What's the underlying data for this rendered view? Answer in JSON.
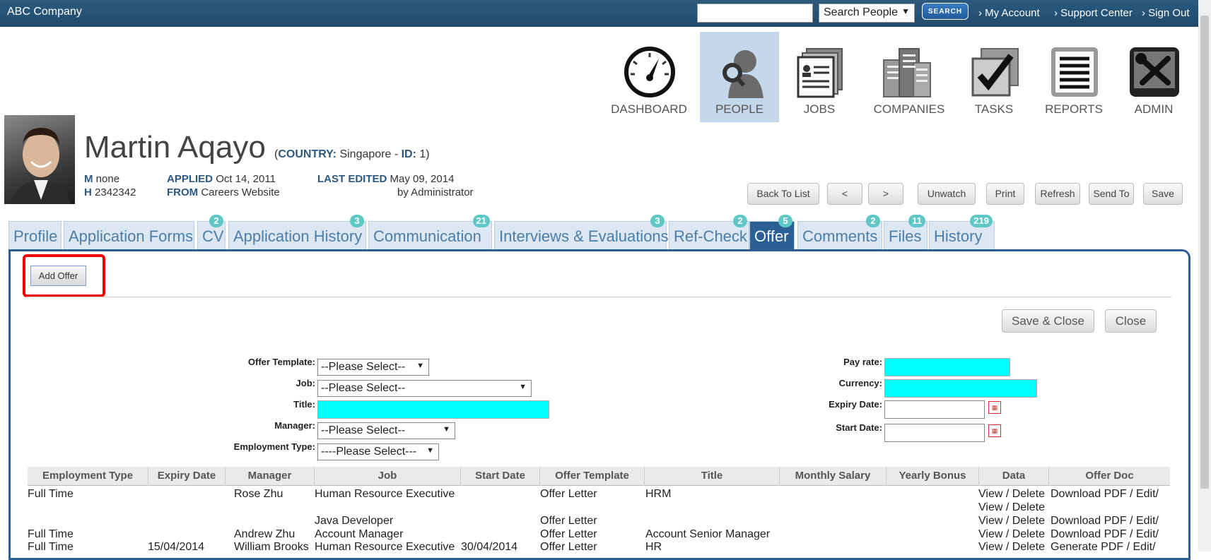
{
  "topbar": {
    "brand": "ABC Company",
    "search_type": "Search People",
    "search_button": "SEARCH",
    "links": [
      "› My Account",
      "› Support Center",
      "› Sign Out"
    ]
  },
  "nav": [
    {
      "label": "DASHBOARD",
      "icon": "dashboard-gauge-icon"
    },
    {
      "label": "PEOPLE",
      "icon": "people-icon"
    },
    {
      "label": "JOBS",
      "icon": "jobs-icon"
    },
    {
      "label": "COMPANIES",
      "icon": "companies-icon"
    },
    {
      "label": "TASKS",
      "icon": "tasks-icon"
    },
    {
      "label": "REPORTS",
      "icon": "reports-icon"
    },
    {
      "label": "ADMIN",
      "icon": "admin-icon"
    }
  ],
  "profile": {
    "name": "Martin Aqayo",
    "country_label": "COUNTRY:",
    "country_value": "Singapore",
    "id_label": "ID:",
    "id_value": "1",
    "m_label": "M",
    "m_value": "none",
    "h_label": "H",
    "h_value": "2342342",
    "applied_label": "APPLIED",
    "applied_value": "Oct 14, 2011",
    "from_label": "FROM",
    "from_value": "Careers Website",
    "last_edited_label": "LAST EDITED",
    "last_edited_value": "May 09, 2014",
    "edited_by": "by Administrator"
  },
  "actions": [
    "Back To List",
    "<",
    ">",
    "Unwatch",
    "Print",
    "Refresh",
    "Send To",
    "Save"
  ],
  "tabs": [
    {
      "label": "Profile",
      "badge": ""
    },
    {
      "label": "Application Forms",
      "badge": ""
    },
    {
      "label": "CV",
      "badge": "2"
    },
    {
      "label": "Application History",
      "badge": "3"
    },
    {
      "label": "Communication",
      "badge": "21"
    },
    {
      "label": "Interviews & Evaluations",
      "badge": "3"
    },
    {
      "label": "Ref-Check",
      "badge": "2"
    },
    {
      "label": "Offer",
      "badge": "5"
    },
    {
      "label": "Comments",
      "badge": "2"
    },
    {
      "label": "Files",
      "badge": "11"
    },
    {
      "label": "History",
      "badge": "219"
    }
  ],
  "offer": {
    "add_offer": "Add Offer",
    "save_close": "Save & Close",
    "close": "Close",
    "form": {
      "offer_template_label": "Offer Template:",
      "offer_template_value": "--Please Select--",
      "job_label": "Job:",
      "job_value": "--Please Select--",
      "title_label": "Title:",
      "manager_label": "Manager:",
      "manager_value": "--Please Select--",
      "employment_type_label": "Employment Type:",
      "employment_type_value": "----Please Select---",
      "pay_rate_label": "Pay rate:",
      "currency_label": "Currency:",
      "expiry_date_label": "Expiry Date:",
      "start_date_label": "Start Date:"
    },
    "columns": [
      "Employment Type",
      "Expiry Date",
      "Manager",
      "Job",
      "Start Date",
      "Offer Template",
      "Title",
      "Monthly Salary",
      "Yearly Bonus",
      "Data",
      "Offer Doc"
    ],
    "rows": [
      {
        "employment_type": "Full Time",
        "expiry": "",
        "manager": "Rose Zhu",
        "job": "Human Resource Executive",
        "start": "",
        "template": "Offer Letter",
        "title": "HRM",
        "data": "View / Delete",
        "doc": "Download PDF / Edit/"
      },
      {
        "employment_type": "",
        "expiry": "",
        "manager": "",
        "job": "",
        "start": "",
        "template": "",
        "title": "",
        "data": "View / Delete",
        "doc": ""
      },
      {
        "employment_type": "",
        "expiry": "",
        "manager": "",
        "job": "Java Developer",
        "start": "",
        "template": "Offer Letter",
        "title": "",
        "data": "View / Delete",
        "doc": "Download PDF / Edit/"
      },
      {
        "employment_type": "Full Time",
        "expiry": "",
        "manager": "Andrew Zhu",
        "job": "Account Manager",
        "start": "",
        "template": "Offer Letter",
        "title": "Account Senior Manager",
        "data": "View / Delete",
        "doc": "Download PDF / Edit/"
      },
      {
        "employment_type": "Full Time",
        "expiry": "15/04/2014",
        "manager": "William Brooks",
        "job": "Human Resource Executive",
        "start": "30/04/2014",
        "template": "Offer Letter",
        "title": "HR",
        "data": "View / Delete",
        "doc": "Generate PDF / Edit/"
      }
    ]
  }
}
